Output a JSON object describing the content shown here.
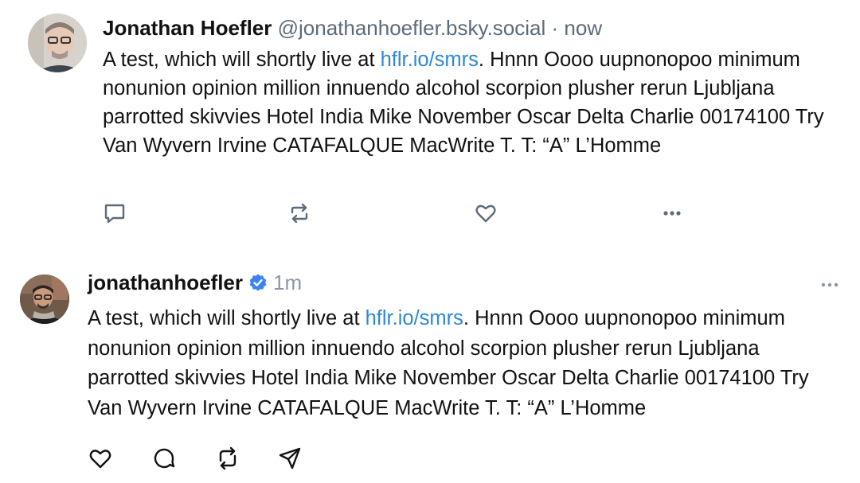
{
  "post1": {
    "display_name": "Jonathan Hoefler",
    "handle": "@jonathanhoefler.bsky.social",
    "separator": "·",
    "time": "now",
    "text_before_link": "A test, which will shortly live at ",
    "link_text": "hflr.io/smrs",
    "text_after_link": ". Hnnn Oooo uupnonopoo minimum nonunion opinion million innuendo alcohol scorpion plusher rerun Ljubljana parrotted skivvies Hotel India Mike November Oscar Delta Charlie 00174100 Try Van Wyvern Irvine CATAFALQUE MacWrite T. T: “A” L’Homme",
    "actions": [
      "reply-icon",
      "repost-icon",
      "like-icon",
      "more-icon"
    ]
  },
  "post2": {
    "username": "jonathanhoefler",
    "time": "1m",
    "text_before_link": "A test, which will shortly live at ",
    "link_text": "hflr.io/smrs",
    "text_after_link": ". Hnnn Oooo uupnonopoo minimum nonunion opinion million innuendo alcohol scorpion plusher rerun Ljubljana parrotted skivvies Hotel India Mike November Oscar Delta Charlie 00174100 Try Van Wyvern Irvine CATAFALQUE MacWrite T. T: “A” L’Homme",
    "actions": [
      "heart-icon",
      "comment-icon",
      "repost-icon",
      "share-icon"
    ]
  },
  "colors": {
    "link": "#2f87d8",
    "meta": "#5c6b7a",
    "icon": "#5c6b7a",
    "verified": "#3b82f6"
  }
}
